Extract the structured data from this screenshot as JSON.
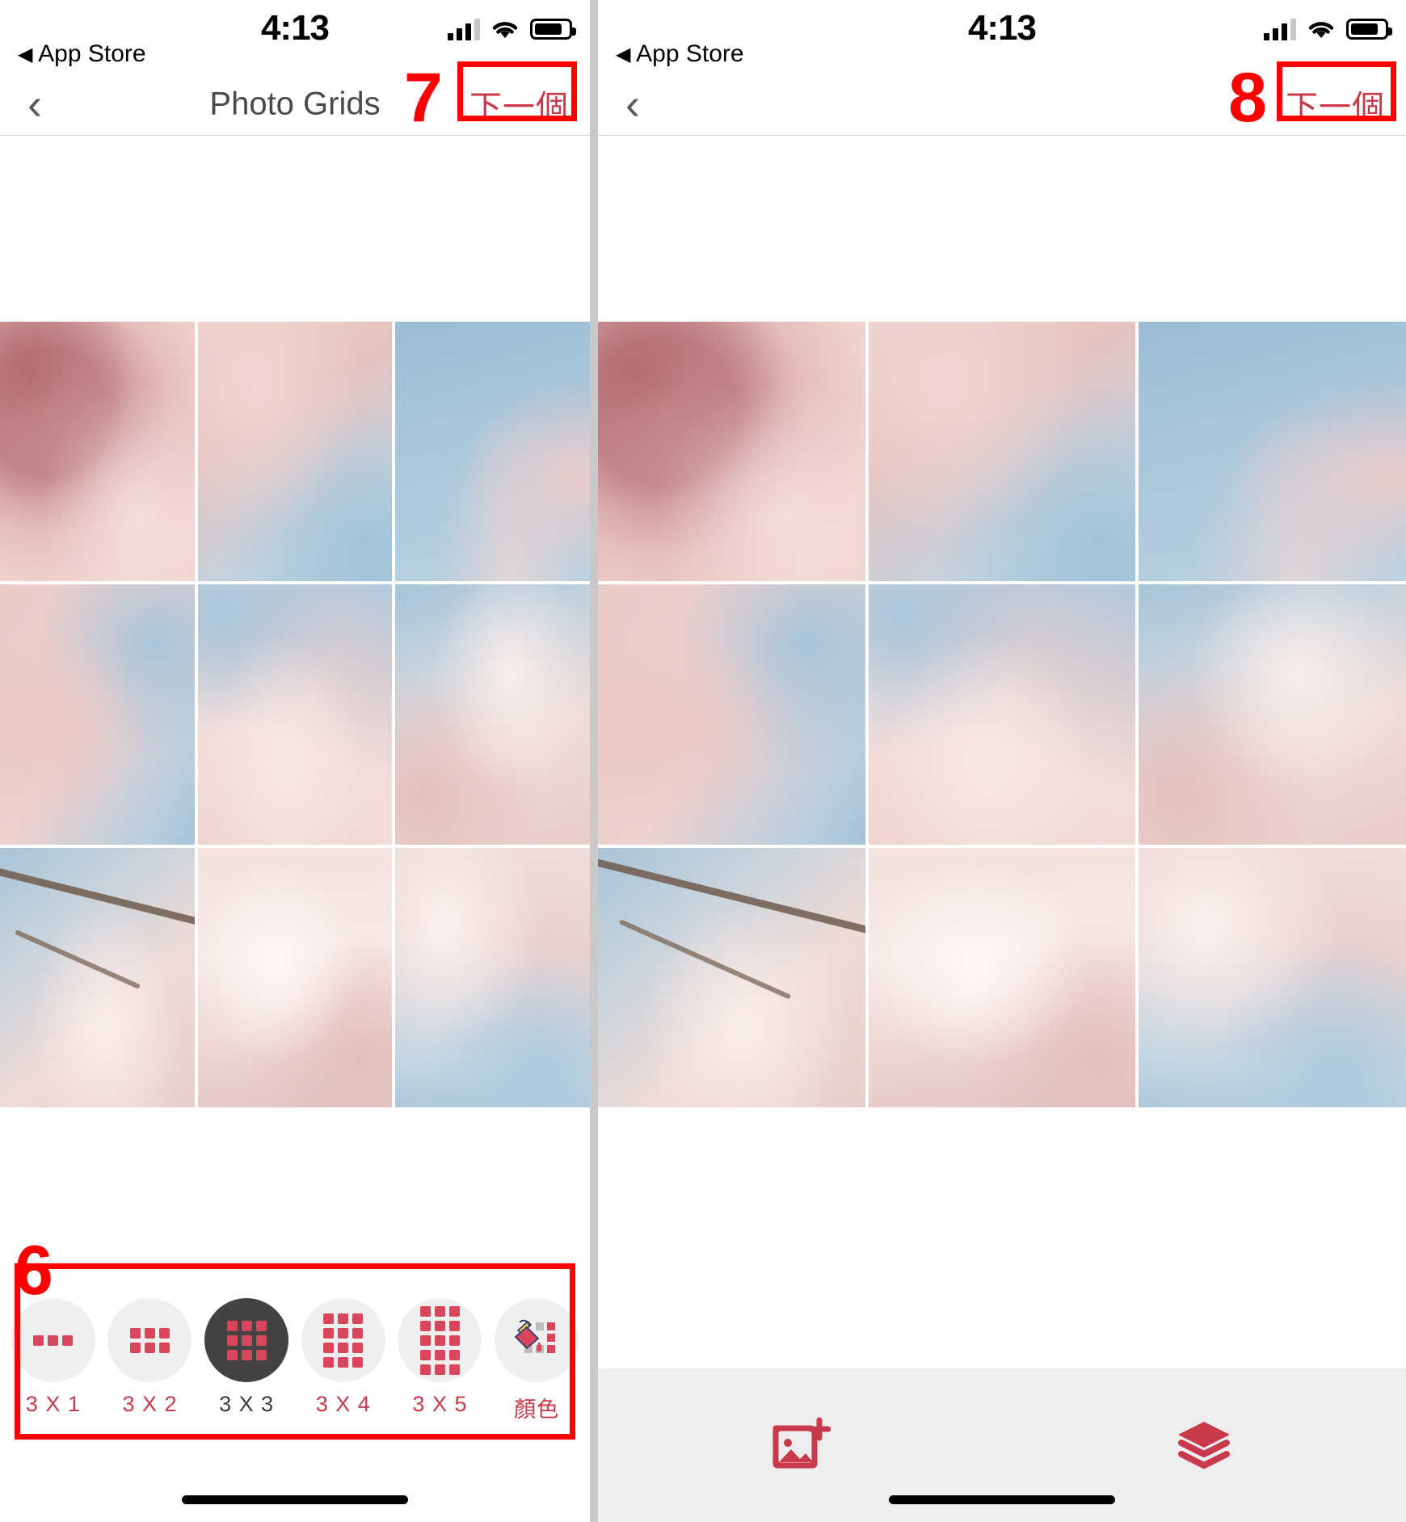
{
  "colors": {
    "accent_red": "#c8394b",
    "annotation_red": "#ff0000",
    "icon_red": "#d9455a",
    "selected_dark": "#434343",
    "bar_gray": "#eeeeee",
    "circle_gray": "#efefef"
  },
  "left_phone": {
    "status": {
      "time": "4:13",
      "back_app_label": "App Store",
      "back_triangle": "◀",
      "signal_icon": "cellular-bars-icon",
      "wifi_icon": "wifi-icon",
      "battery_icon": "battery-icon"
    },
    "nav": {
      "back_icon": "chevron-left-icon",
      "title": "Photo Grids",
      "next_label": "下一個"
    },
    "annotations": {
      "step_next": "7",
      "step_toolbar": "6"
    },
    "photo": {
      "alt": "cherry-blossom-photo",
      "grid_rows": 3,
      "grid_cols": 3
    },
    "toolbar": {
      "items": [
        {
          "label": "3 X 1",
          "icon": "grid-3x1-icon",
          "rows": 1,
          "cols": 3,
          "selected": false
        },
        {
          "label": "3 X 2",
          "icon": "grid-3x2-icon",
          "rows": 2,
          "cols": 3,
          "selected": false
        },
        {
          "label": "3 X 3",
          "icon": "grid-3x3-icon",
          "rows": 3,
          "cols": 3,
          "selected": true
        },
        {
          "label": "3 X 4",
          "icon": "grid-3x4-icon",
          "rows": 4,
          "cols": 3,
          "selected": false
        },
        {
          "label": "3 X 5",
          "icon": "grid-3x5-icon",
          "rows": 5,
          "cols": 3,
          "selected": false
        },
        {
          "label": "顏色",
          "icon": "paint-bucket-icon",
          "rows": 0,
          "cols": 0,
          "selected": false
        }
      ]
    }
  },
  "right_phone": {
    "status": {
      "time": "4:13",
      "back_app_label": "App Store",
      "back_triangle": "◀",
      "signal_icon": "cellular-bars-icon",
      "wifi_icon": "wifi-icon",
      "battery_icon": "battery-icon"
    },
    "nav": {
      "back_icon": "chevron-left-icon",
      "title": "",
      "next_label": "下一個"
    },
    "annotations": {
      "step_next": "8"
    },
    "photo": {
      "alt": "cherry-blossom-photo",
      "grid_rows": 3,
      "grid_cols": 3
    },
    "bottom_bar": {
      "add_photo_icon": "add-image-icon",
      "layers_icon": "layers-icon"
    }
  }
}
